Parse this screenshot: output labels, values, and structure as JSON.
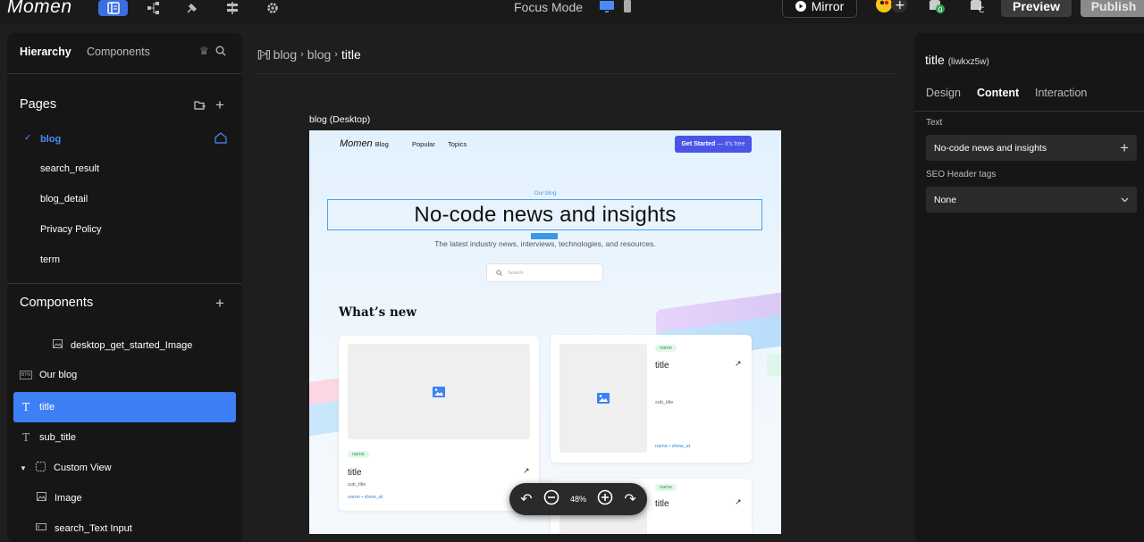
{
  "topbar": {
    "logo": "Momen",
    "focus_mode": "Focus Mode",
    "mirror_label": "Mirror",
    "preview_label": "Preview",
    "publish_label": "Publish",
    "accent": "#3b6fe0"
  },
  "left_panel": {
    "tabs": [
      "Hierarchy",
      "Components"
    ],
    "pages_title": "Pages",
    "pages": [
      "blog",
      "search_result",
      "blog_detail",
      "Privacy Policy",
      "term"
    ],
    "components_title": "Components",
    "components": [
      {
        "label": "desktop_get_started_Image",
        "icon": "image-icon"
      },
      {
        "label": "Our blog",
        "icon": "button-icon"
      },
      {
        "label": "title",
        "icon": "text-icon"
      },
      {
        "label": "sub_title",
        "icon": "text-icon"
      },
      {
        "label": "Custom View",
        "icon": "view-icon"
      },
      {
        "label": "Image",
        "icon": "image-icon"
      },
      {
        "label": "search_Text Input",
        "icon": "input-icon"
      }
    ],
    "selected_color": "#3d80f5"
  },
  "breadcrumb": {
    "parts": [
      "blog",
      "blog"
    ],
    "current": "title"
  },
  "canvas": {
    "label": "blog (Desktop)",
    "nav": {
      "logo": "Momen",
      "logo_suffix": "Blog",
      "links": [
        "Popular",
        "Topics"
      ],
      "cta": "Get Started",
      "cta_suffix": "— it's free"
    },
    "eyebrow": "Our blog",
    "title": "No-code news and insights",
    "subtitle": "The latest industry news, interviews, technologies, and resources.",
    "search_placeholder": "Search",
    "section_title": "What’s new",
    "cards": [
      {
        "tag": "name",
        "title": "title",
        "sub": "sub_title",
        "meta": "name • show_at"
      },
      {
        "tag": "name",
        "title": "title",
        "sub": "sub_title",
        "meta": "name • show_at"
      },
      {
        "tag": "name",
        "title": "title"
      }
    ]
  },
  "zoom": {
    "value": "48%"
  },
  "right_panel": {
    "title": "title",
    "id": "(liwkxz5w)",
    "tabs": [
      "Design",
      "Content",
      "Interaction"
    ],
    "text_label": "Text",
    "text_value": "No-code news and insights",
    "seo_label": "SEO Header tags",
    "seo_value": "None"
  }
}
